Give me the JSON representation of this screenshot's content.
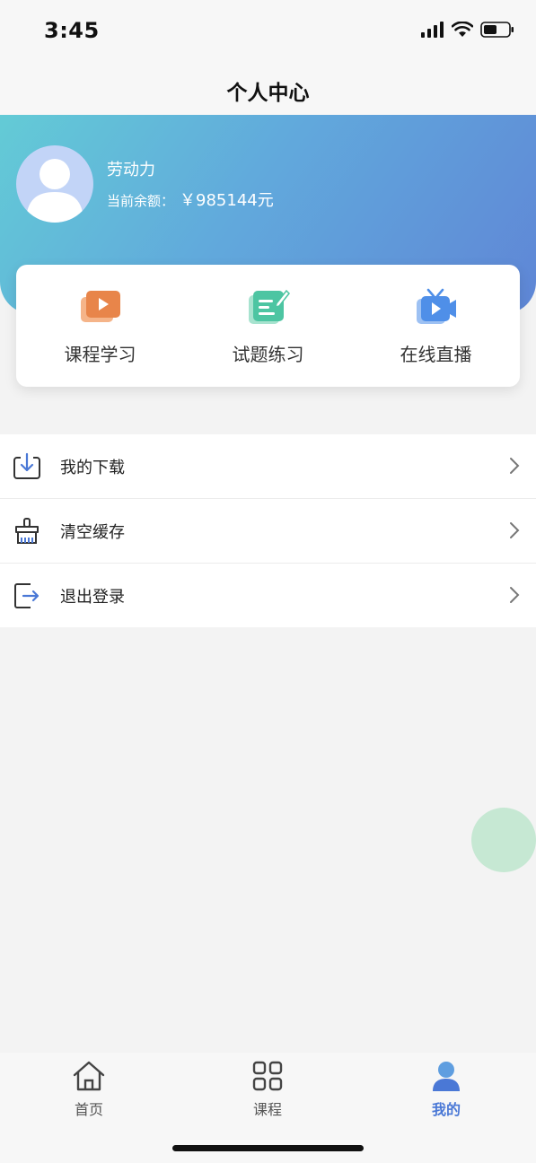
{
  "status_bar": {
    "time": "3:45"
  },
  "nav": {
    "title": "个人中心"
  },
  "profile": {
    "name": "劳动力",
    "balance_label": "当前余额：",
    "balance_value": "￥985144元"
  },
  "quick_actions": [
    {
      "label": "课程学习",
      "icon": "course-video-icon",
      "color": "#e8854a"
    },
    {
      "label": "试题练习",
      "icon": "exercise-note-icon",
      "color": "#4dc5a2"
    },
    {
      "label": "在线直播",
      "icon": "live-tv-icon",
      "color": "#4f8fe8"
    }
  ],
  "menu": [
    {
      "label": "我的下载",
      "icon": "download-icon"
    },
    {
      "label": "清空缓存",
      "icon": "broom-icon"
    },
    {
      "label": "退出登录",
      "icon": "logout-icon"
    }
  ],
  "tabbar": [
    {
      "label": "首页",
      "icon": "home-icon",
      "active": false
    },
    {
      "label": "课程",
      "icon": "grid-icon",
      "active": false
    },
    {
      "label": "我的",
      "icon": "user-icon",
      "active": true
    }
  ],
  "colors": {
    "accent": "#4a78d6",
    "header_start": "#63cbd6",
    "header_end": "#5f86d6"
  }
}
